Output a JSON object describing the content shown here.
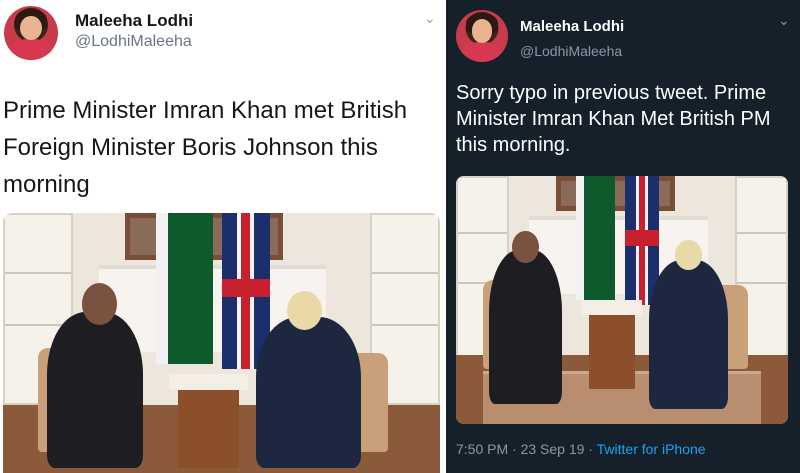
{
  "left_tweet": {
    "name": "Maleeha Lodhi",
    "handle": "@LodhiMaleeha",
    "text": "Prime Minister Imran Khan met British Foreign Minister Boris Johnson this morning"
  },
  "right_tweet": {
    "name": "Maleeha Lodhi",
    "handle": "@LodhiMaleeha",
    "text": "Sorry typo in previous tweet. Prime Minister Imran Khan Met British PM this morning.",
    "time": "7:50 PM",
    "separator_1": "·",
    "date": "23 Sep 19",
    "separator_2": "·",
    "source": "Twitter for iPhone"
  },
  "icons": {
    "menu": "chevron-down-icon",
    "avatar": "profile-photo"
  },
  "colors": {
    "dark_bg": "#15202b",
    "link": "#1da1f2",
    "muted_dark": "#8899a6",
    "muted_light": "#657786"
  }
}
